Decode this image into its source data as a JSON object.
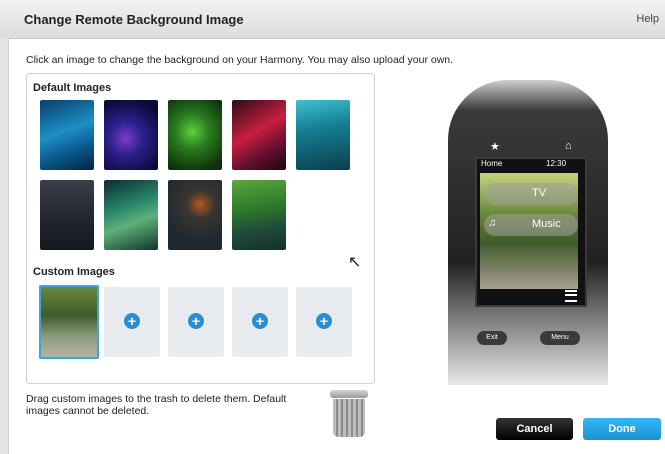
{
  "window": {
    "title": "Change Remote Background Image",
    "help_label": "Help"
  },
  "instructions": "Click an image to change the background on your Harmony. You may also upload your own.",
  "default_images": {
    "label": "Default Images",
    "items": [
      "t1",
      "t2",
      "t3",
      "t4",
      "t5",
      "t6",
      "t7",
      "t8",
      "t9"
    ]
  },
  "custom_images": {
    "label": "Custom Images"
  },
  "drag_note": "Drag custom images to the trash to delete them. Default images cannot be deleted.",
  "remote_preview": {
    "status": "Home",
    "time": "12:30",
    "activities": [
      "TV",
      "Music"
    ],
    "buttons": [
      "Exit",
      "Menu"
    ]
  },
  "actions": {
    "cancel": "Cancel",
    "done": "Done"
  },
  "colors": {
    "accent": "#1b93d6",
    "selected_border": "#3aa6dc"
  }
}
